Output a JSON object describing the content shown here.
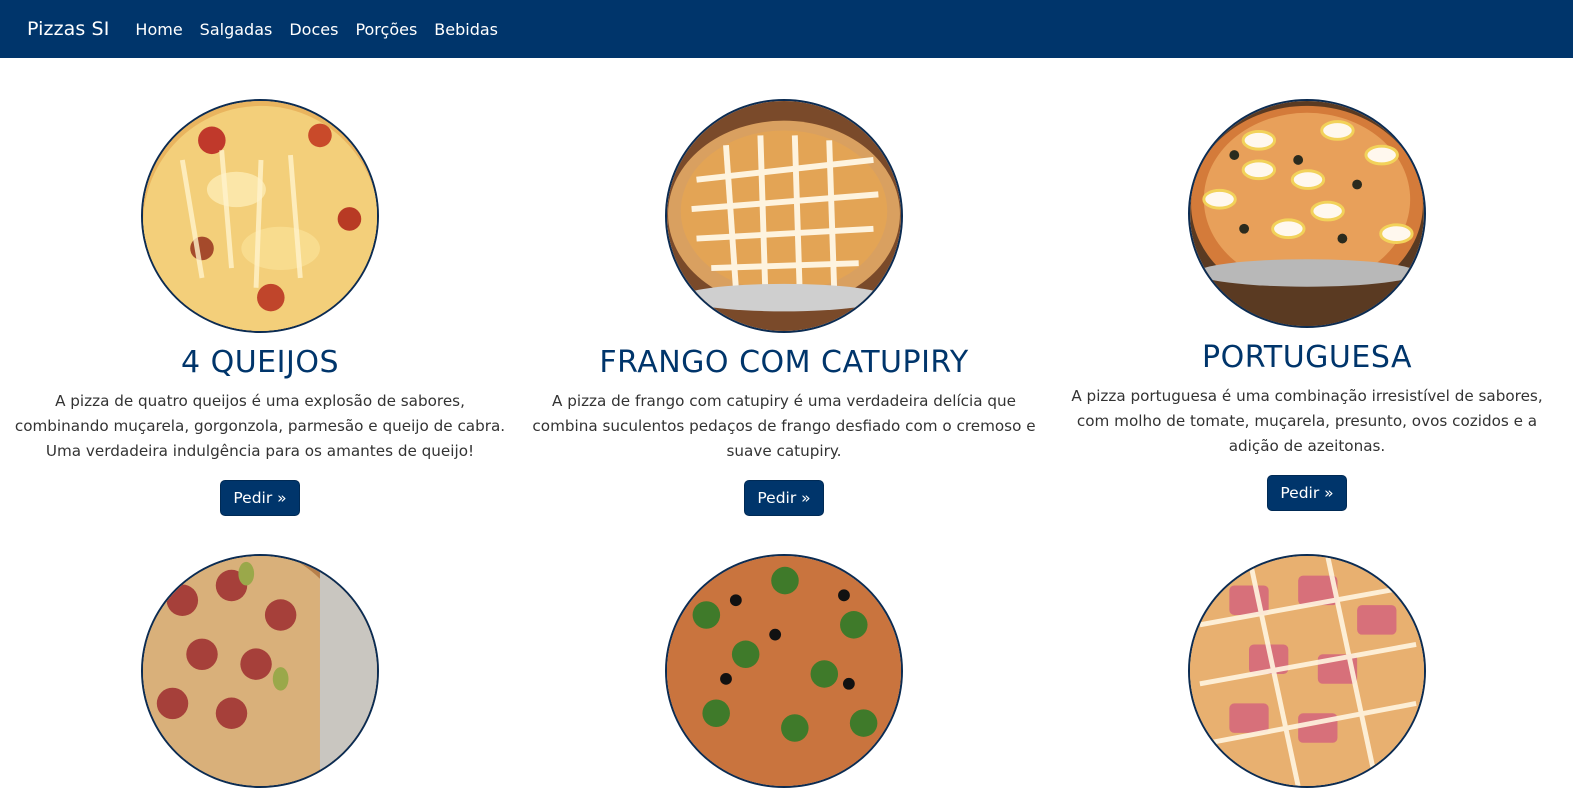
{
  "navbar": {
    "brand": "Pizzas SI",
    "links": [
      "Home",
      "Salgadas",
      "Doces",
      "Porções",
      "Bebidas"
    ]
  },
  "products": [
    {
      "title": "4 QUEIJOS",
      "description": "A pizza de quatro queijos é uma explosão de sabores, combinando muçarela, gorgonzola, parmesão e queijo de cabra. Uma verdadeira indulgência para os amantes de queijo!",
      "button": "Pedir »"
    },
    {
      "title": "FRANGO COM CATUPIRY",
      "description": "A pizza de frango com catupiry é uma verdadeira delícia que combina suculentos pedaços de frango desfiado com o cremoso e suave catupiry.",
      "button": "Pedir »"
    },
    {
      "title": "PORTUGUESA",
      "description": "A pizza portuguesa é uma combinação irresistível de sabores, com molho de tomate, muçarela, presunto, ovos cozidos e a adição de azeitonas.",
      "button": "Pedir »"
    }
  ],
  "colors": {
    "primary": "#00356b",
    "image_border": "#0c2c52"
  }
}
